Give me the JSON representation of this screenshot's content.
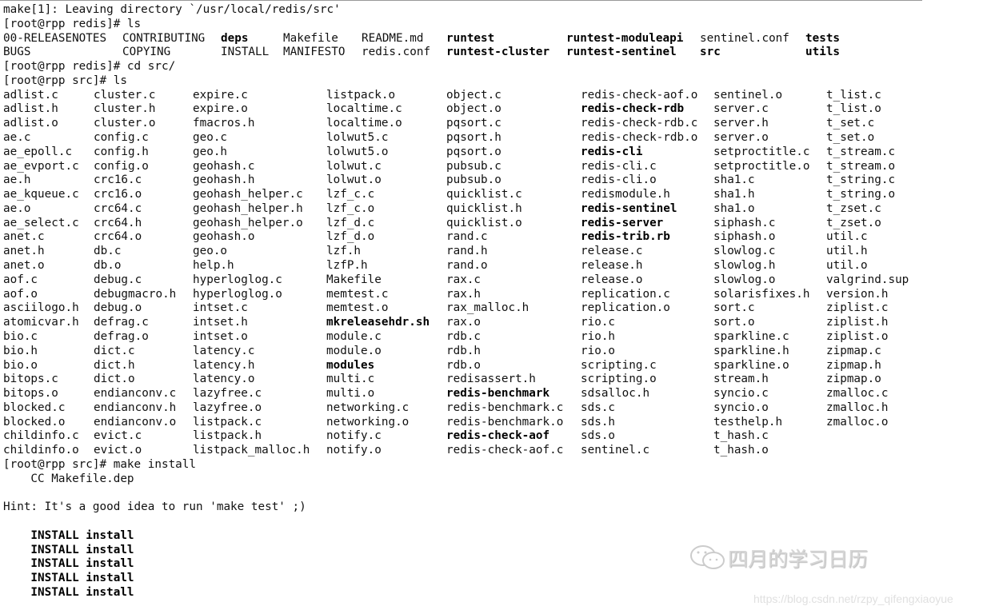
{
  "terminal": {
    "pre_lines": [
      "make[1]: Leaving directory `/usr/local/redis/src'",
      "[root@rpp redis]# ls"
    ],
    "root_ls": [
      [
        "00-RELEASENOTES",
        "CONTRIBUTING",
        "deps",
        "Makefile",
        "README.md",
        "runtest",
        "runtest-moduleapi",
        "sentinel.conf",
        "tests"
      ],
      [
        "BUGS",
        "COPYING",
        "INSTALL",
        "MANIFESTO",
        "redis.conf",
        "runtest-cluster",
        "runtest-sentinel",
        "src",
        "utils"
      ]
    ],
    "mid_lines": [
      "[root@rpp redis]# cd src/",
      "[root@rpp src]# ls"
    ],
    "src_ls_columns": [
      [
        "adlist.c",
        "adlist.h",
        "adlist.o",
        "ae.c",
        "ae_epoll.c",
        "ae_evport.c",
        "ae.h",
        "ae_kqueue.c",
        "ae.o",
        "ae_select.c",
        "anet.c",
        "anet.h",
        "anet.o",
        "aof.c",
        "aof.o",
        "asciilogo.h",
        "atomicvar.h",
        "bio.c",
        "bio.h",
        "bio.o",
        "bitops.c",
        "bitops.o",
        "blocked.c",
        "blocked.o",
        "childinfo.c",
        "childinfo.o"
      ],
      [
        "cluster.c",
        "cluster.h",
        "cluster.o",
        "config.c",
        "config.h",
        "config.o",
        "crc16.c",
        "crc16.o",
        "crc64.c",
        "crc64.h",
        "crc64.o",
        "db.c",
        "db.o",
        "debug.c",
        "debugmacro.h",
        "debug.o",
        "defrag.c",
        "defrag.o",
        "dict.c",
        "dict.h",
        "dict.o",
        "endianconv.c",
        "endianconv.h",
        "endianconv.o",
        "evict.c",
        "evict.o"
      ],
      [
        "expire.c",
        "expire.o",
        "fmacros.h",
        "geo.c",
        "geo.h",
        "geohash.c",
        "geohash.h",
        "geohash_helper.c",
        "geohash_helper.h",
        "geohash_helper.o",
        "geohash.o",
        "geo.o",
        "help.h",
        "hyperloglog.c",
        "hyperloglog.o",
        "intset.c",
        "intset.h",
        "intset.o",
        "latency.c",
        "latency.h",
        "latency.o",
        "lazyfree.c",
        "lazyfree.o",
        "listpack.c",
        "listpack.h",
        "listpack_malloc.h"
      ],
      [
        "listpack.o",
        "localtime.c",
        "localtime.o",
        "lolwut5.c",
        "lolwut5.o",
        "lolwut.c",
        "lolwut.o",
        "lzf_c.c",
        "lzf_c.o",
        "lzf_d.c",
        "lzf_d.o",
        "lzf.h",
        "lzfP.h",
        "Makefile",
        "memtest.c",
        "memtest.o",
        "mkreleasehdr.sh",
        "module.c",
        "module.o",
        "modules",
        "multi.c",
        "multi.o",
        "networking.c",
        "networking.o",
        "notify.c",
        "notify.o"
      ],
      [
        "object.c",
        "object.o",
        "pqsort.c",
        "pqsort.h",
        "pqsort.o",
        "pubsub.c",
        "pubsub.o",
        "quicklist.c",
        "quicklist.h",
        "quicklist.o",
        "rand.c",
        "rand.h",
        "rand.o",
        "rax.c",
        "rax.h",
        "rax_malloc.h",
        "rax.o",
        "rdb.c",
        "rdb.h",
        "rdb.o",
        "redisassert.h",
        "redis-benchmark",
        "redis-benchmark.c",
        "redis-benchmark.o",
        "redis-check-aof",
        "redis-check-aof.c"
      ],
      [
        "redis-check-aof.o",
        "redis-check-rdb",
        "redis-check-rdb.c",
        "redis-check-rdb.o",
        "redis-cli",
        "redis-cli.c",
        "redis-cli.o",
        "redismodule.h",
        "redis-sentinel",
        "redis-server",
        "redis-trib.rb",
        "release.c",
        "release.h",
        "release.o",
        "replication.c",
        "replication.o",
        "rio.c",
        "rio.h",
        "rio.o",
        "scripting.c",
        "scripting.o",
        "sdsalloc.h",
        "sds.c",
        "sds.h",
        "sds.o",
        "sentinel.c"
      ],
      [
        "sentinel.o",
        "server.c",
        "server.h",
        "server.o",
        "setproctitle.c",
        "setproctitle.o",
        "sha1.c",
        "sha1.h",
        "sha1.o",
        "siphash.c",
        "siphash.o",
        "slowlog.c",
        "slowlog.h",
        "slowlog.o",
        "solarisfixes.h",
        "sort.c",
        "sort.o",
        "sparkline.c",
        "sparkline.h",
        "sparkline.o",
        "stream.h",
        "syncio.c",
        "syncio.o",
        "testhelp.h",
        "t_hash.c",
        "t_hash.o"
      ],
      [
        "t_list.c",
        "t_list.o",
        "t_set.c",
        "t_set.o",
        "t_stream.c",
        "t_stream.o",
        "t_string.c",
        "t_string.o",
        "t_zset.c",
        "t_zset.o",
        "util.c",
        "util.h",
        "util.o",
        "valgrind.sup",
        "version.h",
        "ziplist.c",
        "ziplist.h",
        "ziplist.o",
        "zipmap.c",
        "zipmap.h",
        "zipmap.o",
        "zmalloc.c",
        "zmalloc.h",
        "zmalloc.o"
      ]
    ],
    "bold_entries": [
      "deps",
      "runtest",
      "runtest-moduleapi",
      "tests",
      "runtest-cluster",
      "runtest-sentinel",
      "src",
      "utils",
      "mkreleasehdr.sh",
      "modules",
      "redis-benchmark",
      "redis-check-aof",
      "redis-check-rdb",
      "redis-cli",
      "redis-sentinel",
      "redis-server",
      "redis-trib.rb"
    ],
    "post_lines": [
      {
        "text": "[root@rpp src]# make install",
        "bold": false
      },
      {
        "text": "    CC Makefile.dep",
        "bold": false
      },
      {
        "text": "",
        "bold": false
      },
      {
        "text": "Hint: It's a good idea to run 'make test' ;)",
        "bold": false
      },
      {
        "text": "",
        "bold": false
      },
      {
        "text": "    INSTALL install",
        "bold": true
      },
      {
        "text": "    INSTALL install",
        "bold": true
      },
      {
        "text": "    INSTALL install",
        "bold": true
      },
      {
        "text": "    INSTALL install",
        "bold": true
      },
      {
        "text": "    INSTALL install",
        "bold": true
      }
    ]
  },
  "watermark": {
    "icon": "wechat-icon",
    "text": "四月的学习日历",
    "url": "https://blog.csdn.net/rzpy_qifengxiaoyue"
  }
}
